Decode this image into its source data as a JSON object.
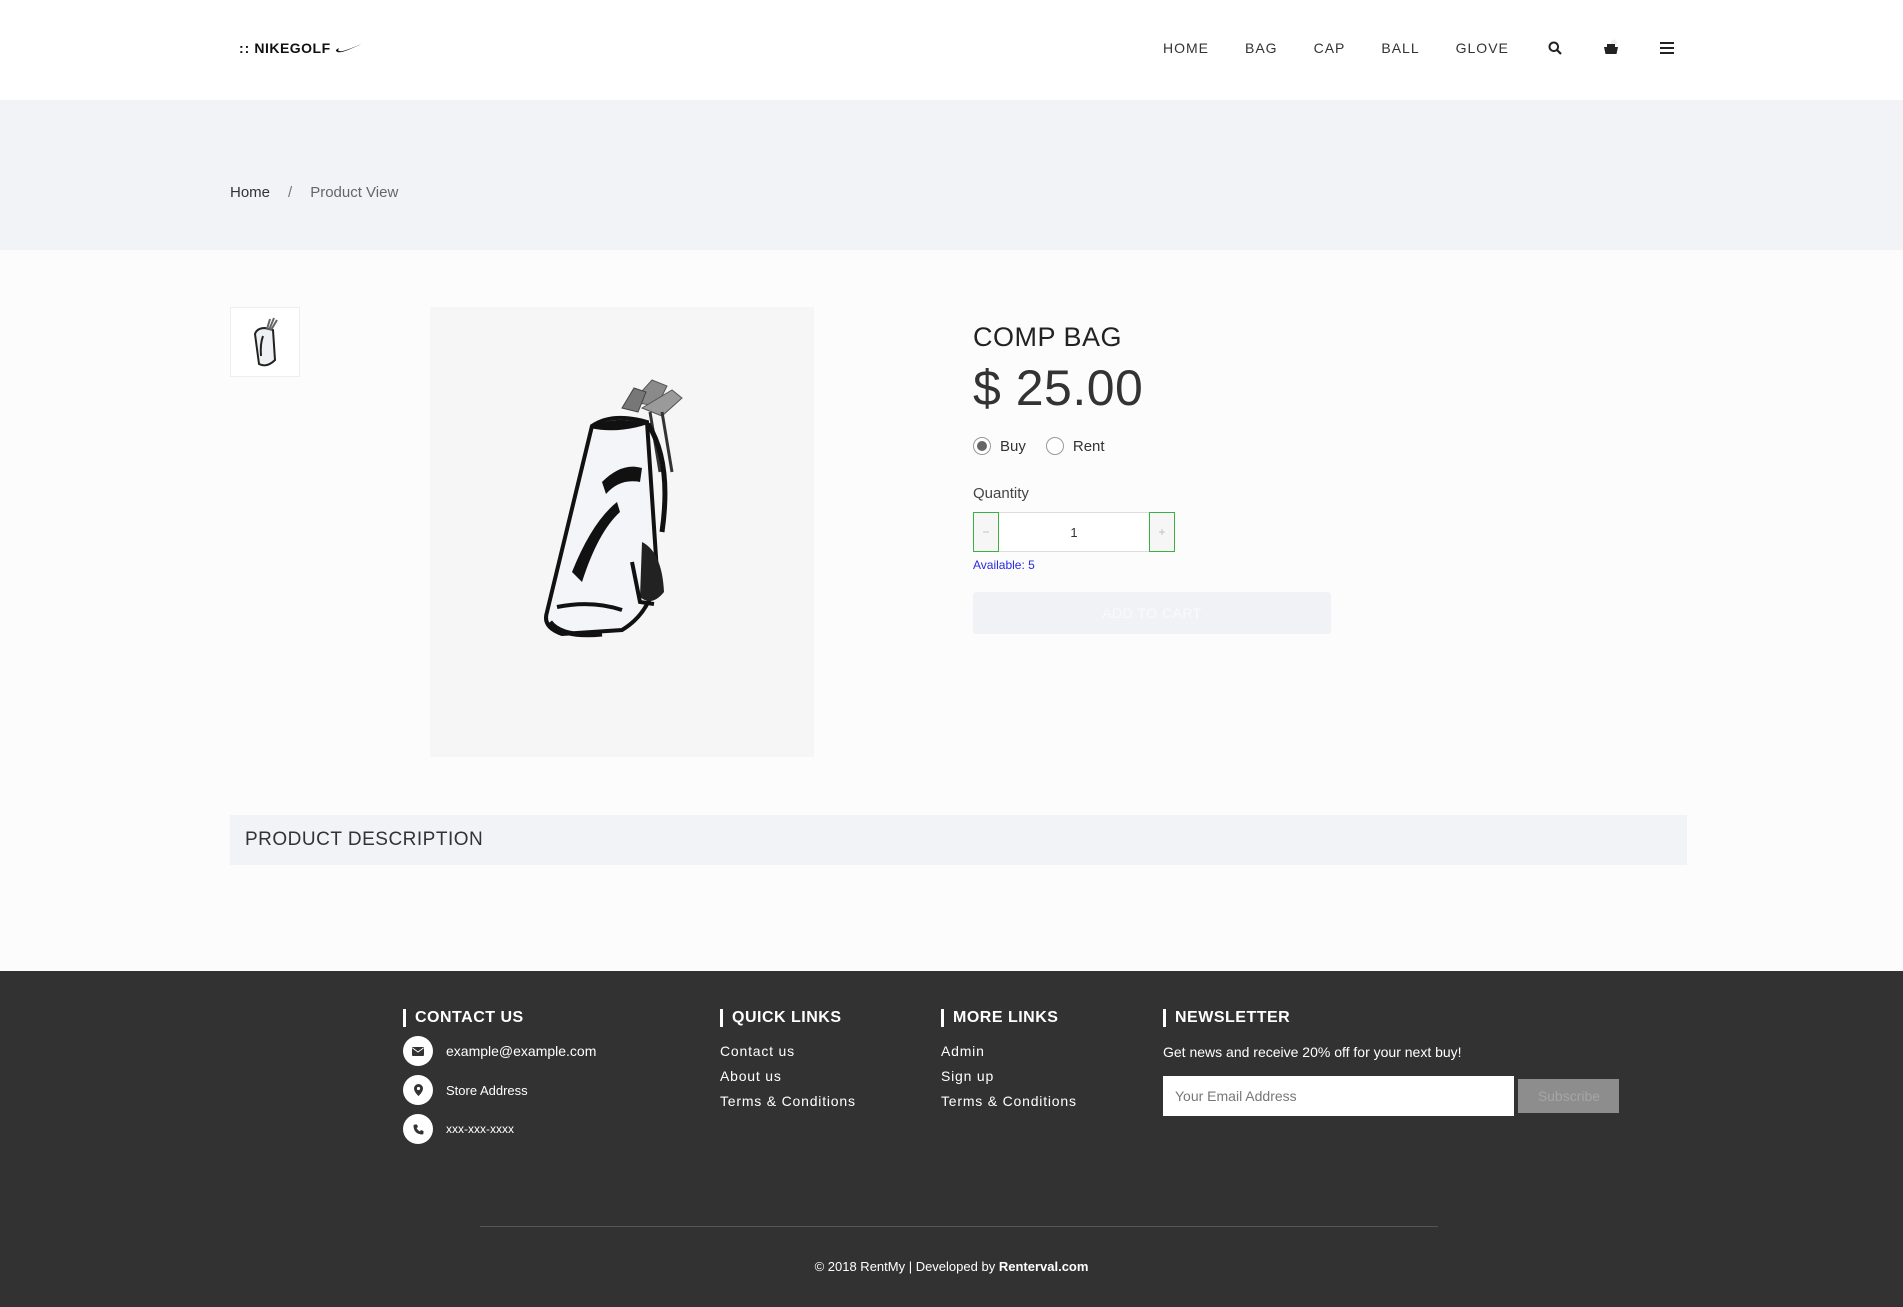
{
  "header": {
    "logo_dots": "::",
    "logo_text": "NIKEGOLF",
    "nav": [
      "HOME",
      "BAG",
      "CAP",
      "BALL",
      "GLOVE"
    ]
  },
  "breadcrumb": {
    "home": "Home",
    "separator": "/",
    "current": "Product View"
  },
  "product": {
    "title": "COMP BAG",
    "price": "$ 25.00",
    "options": [
      "Buy",
      "Rent"
    ],
    "selected_option": "Buy",
    "quantity_label": "Quantity",
    "quantity_value": "1",
    "minus": "−",
    "plus": "+",
    "available": "Available: 5",
    "add_to_cart": "ADD TO CART",
    "description_heading": "PRODUCT DESCRIPTION"
  },
  "footer": {
    "contact": {
      "heading": "CONTACT US",
      "email": "example@example.com",
      "address": "Store Address",
      "phone": "xxx-xxx-xxxx"
    },
    "quick_links": {
      "heading": "QUICK LINKS",
      "items": [
        "Contact us",
        "About us",
        "Terms & Conditions"
      ]
    },
    "more_links": {
      "heading": "MORE LINKS",
      "items": [
        "Admin",
        "Sign up",
        "Terms & Conditions"
      ]
    },
    "newsletter": {
      "heading": "NEWSLETTER",
      "text": "Get news and receive 20% off for your next buy!",
      "placeholder": "Your Email Address",
      "button": "Subscribe"
    },
    "copyright": "© 2018 RentMy | Developed by",
    "developer": "Renterval.com"
  },
  "icons": [
    "search-icon",
    "cart-icon",
    "menu-icon",
    "envelope-icon",
    "map-marker-icon",
    "phone-icon",
    "nike-swoosh-icon"
  ],
  "colors": {
    "accent_green": "#3cb043",
    "available_blue": "#2a2ae0",
    "footer_bg": "#323232",
    "band_bg": "#f2f3f7"
  }
}
